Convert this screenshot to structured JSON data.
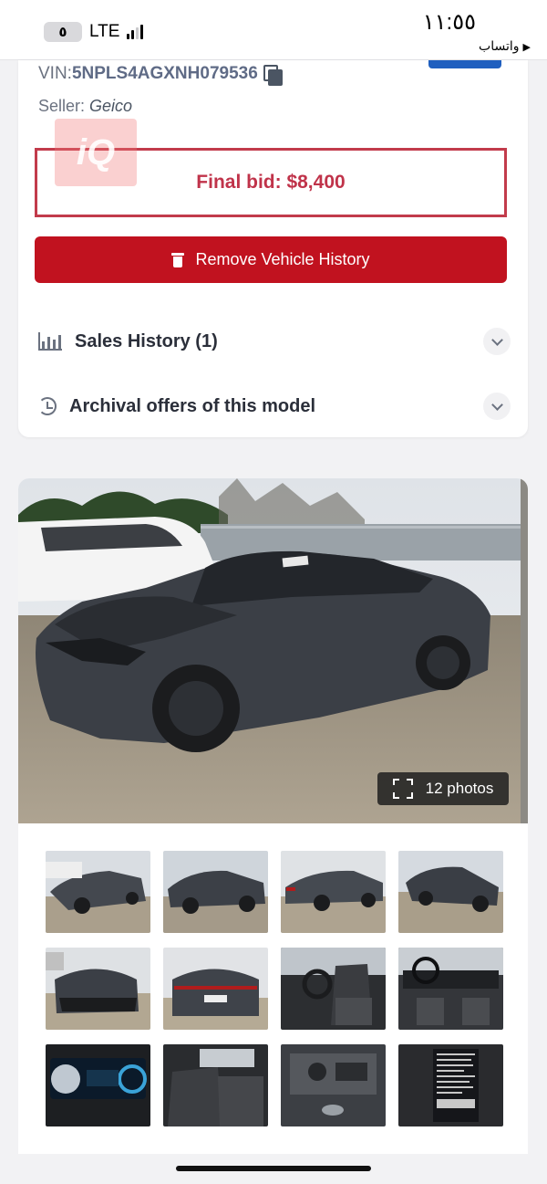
{
  "status_bar": {
    "battery": "٥",
    "network": "LTE",
    "time": "١١:٥٥",
    "back_app": "واتساب",
    "back_arrow": "▶"
  },
  "vehicle": {
    "vin_label": "VIN: ",
    "vin_value": "5NPLS4AGXNH079536",
    "seller_label": "Seller: ",
    "seller_value": "Geico",
    "final_bid": "Final bid: $8,400",
    "watermark": "iQ"
  },
  "actions": {
    "remove_history": "Remove Vehicle History"
  },
  "sections": {
    "sales_history": "Sales History (1)",
    "archival_offers": "Archival offers of this model"
  },
  "gallery": {
    "photos_count_label": "12 photos",
    "thumbnails": [
      "front-left-view",
      "left-side-view",
      "rear-left-view",
      "right-front-view",
      "front-damage-view",
      "rear-view",
      "front-seats-view",
      "dashboard-view",
      "instrument-cluster",
      "rear-seats-view",
      "engine-bay",
      "vin-label-sticker"
    ]
  },
  "colors": {
    "accent_red": "#c1121f",
    "bid_red": "#c0334a",
    "car_body": "#3b3f46"
  }
}
